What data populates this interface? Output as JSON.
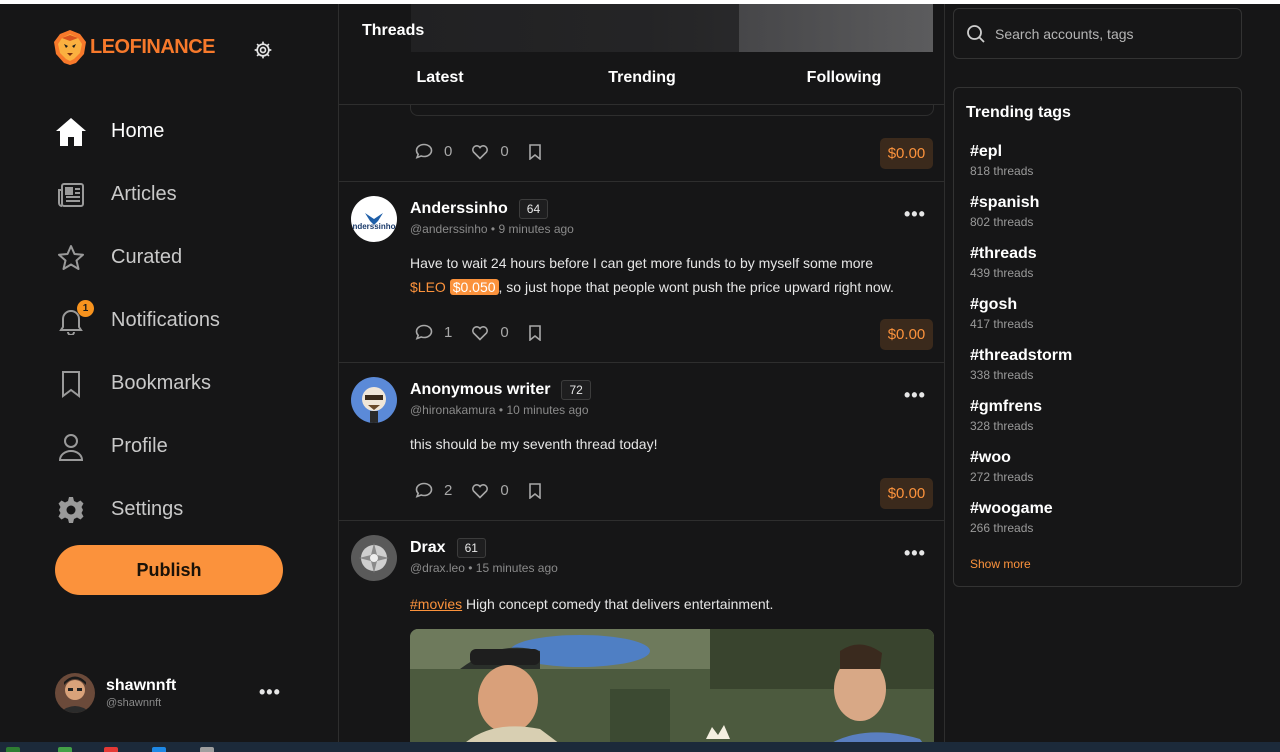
{
  "brand": {
    "logo_text": "LEOFINANCE",
    "accent": "#fb923c"
  },
  "nav": {
    "items": [
      {
        "label": "Home",
        "icon": "home-icon",
        "active": true
      },
      {
        "label": "Articles",
        "icon": "newspaper-icon"
      },
      {
        "label": "Curated",
        "icon": "star-icon"
      },
      {
        "label": "Notifications",
        "icon": "bell-icon",
        "badge": "1"
      },
      {
        "label": "Bookmarks",
        "icon": "bookmark-icon"
      },
      {
        "label": "Profile",
        "icon": "user-icon"
      },
      {
        "label": "Settings",
        "icon": "gear-icon"
      }
    ],
    "publish_label": "Publish"
  },
  "current_user": {
    "name": "shawnnft",
    "handle": "@shawnnft",
    "more": "•••"
  },
  "feed": {
    "title": "Threads",
    "tabs": [
      "Latest",
      "Trending",
      "Following"
    ],
    "active_tab": "Latest",
    "top_post": {
      "comments": "0",
      "likes": "0",
      "tip": "$0.00"
    },
    "posts": [
      {
        "name": "Anderssinho",
        "rep": "64",
        "handle": "@anderssinho",
        "sep": "•",
        "time": "9 minutes ago",
        "text_1": "Have to wait 24 hours before I can get more funds to by myself some more",
        "ticker": "$LEO",
        "price": "$0.050",
        "text_2": ", so just hope that people wont push the price upward right now.",
        "comments": "1",
        "likes": "0",
        "tip": "$0.00",
        "avatar_text": "nderssinho"
      },
      {
        "name": "Anonymous writer",
        "rep": "72",
        "handle": "@hironakamura",
        "sep": "•",
        "time": "10 minutes ago",
        "text": "this should be my seventh thread today!",
        "comments": "2",
        "likes": "0",
        "tip": "$0.00"
      },
      {
        "name": "Drax",
        "rep": "61",
        "handle": "@drax.leo",
        "sep": "•",
        "time": "15 minutes ago",
        "tag": "#movies",
        "text": " High concept comedy that delivers entertainment."
      }
    ],
    "more": "•••"
  },
  "search": {
    "placeholder": "Search accounts, tags"
  },
  "trending": {
    "title": "Trending tags",
    "tags": [
      {
        "tag": "#epl",
        "count": "818 threads"
      },
      {
        "tag": "#spanish",
        "count": "802 threads"
      },
      {
        "tag": "#threads",
        "count": "439 threads"
      },
      {
        "tag": "#gosh",
        "count": "417 threads"
      },
      {
        "tag": "#threadstorm",
        "count": "338 threads"
      },
      {
        "tag": "#gmfrens",
        "count": "328 threads"
      },
      {
        "tag": "#woo",
        "count": "272 threads"
      },
      {
        "tag": "#woogame",
        "count": "266 threads"
      }
    ],
    "show_more": "Show more"
  }
}
